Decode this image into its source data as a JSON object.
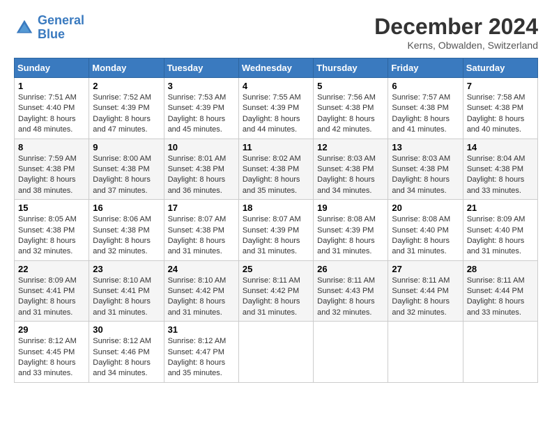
{
  "header": {
    "logo_line1": "General",
    "logo_line2": "Blue",
    "month": "December 2024",
    "location": "Kerns, Obwalden, Switzerland"
  },
  "columns": [
    "Sunday",
    "Monday",
    "Tuesday",
    "Wednesday",
    "Thursday",
    "Friday",
    "Saturday"
  ],
  "weeks": [
    [
      {
        "day": "1",
        "sunrise": "7:51 AM",
        "sunset": "4:40 PM",
        "daylight": "8 hours and 48 minutes."
      },
      {
        "day": "2",
        "sunrise": "7:52 AM",
        "sunset": "4:39 PM",
        "daylight": "8 hours and 47 minutes."
      },
      {
        "day": "3",
        "sunrise": "7:53 AM",
        "sunset": "4:39 PM",
        "daylight": "8 hours and 45 minutes."
      },
      {
        "day": "4",
        "sunrise": "7:55 AM",
        "sunset": "4:39 PM",
        "daylight": "8 hours and 44 minutes."
      },
      {
        "day": "5",
        "sunrise": "7:56 AM",
        "sunset": "4:38 PM",
        "daylight": "8 hours and 42 minutes."
      },
      {
        "day": "6",
        "sunrise": "7:57 AM",
        "sunset": "4:38 PM",
        "daylight": "8 hours and 41 minutes."
      },
      {
        "day": "7",
        "sunrise": "7:58 AM",
        "sunset": "4:38 PM",
        "daylight": "8 hours and 40 minutes."
      }
    ],
    [
      {
        "day": "8",
        "sunrise": "7:59 AM",
        "sunset": "4:38 PM",
        "daylight": "8 hours and 38 minutes."
      },
      {
        "day": "9",
        "sunrise": "8:00 AM",
        "sunset": "4:38 PM",
        "daylight": "8 hours and 37 minutes."
      },
      {
        "day": "10",
        "sunrise": "8:01 AM",
        "sunset": "4:38 PM",
        "daylight": "8 hours and 36 minutes."
      },
      {
        "day": "11",
        "sunrise": "8:02 AM",
        "sunset": "4:38 PM",
        "daylight": "8 hours and 35 minutes."
      },
      {
        "day": "12",
        "sunrise": "8:03 AM",
        "sunset": "4:38 PM",
        "daylight": "8 hours and 34 minutes."
      },
      {
        "day": "13",
        "sunrise": "8:03 AM",
        "sunset": "4:38 PM",
        "daylight": "8 hours and 34 minutes."
      },
      {
        "day": "14",
        "sunrise": "8:04 AM",
        "sunset": "4:38 PM",
        "daylight": "8 hours and 33 minutes."
      }
    ],
    [
      {
        "day": "15",
        "sunrise": "8:05 AM",
        "sunset": "4:38 PM",
        "daylight": "8 hours and 32 minutes."
      },
      {
        "day": "16",
        "sunrise": "8:06 AM",
        "sunset": "4:38 PM",
        "daylight": "8 hours and 32 minutes."
      },
      {
        "day": "17",
        "sunrise": "8:07 AM",
        "sunset": "4:38 PM",
        "daylight": "8 hours and 31 minutes."
      },
      {
        "day": "18",
        "sunrise": "8:07 AM",
        "sunset": "4:39 PM",
        "daylight": "8 hours and 31 minutes."
      },
      {
        "day": "19",
        "sunrise": "8:08 AM",
        "sunset": "4:39 PM",
        "daylight": "8 hours and 31 minutes."
      },
      {
        "day": "20",
        "sunrise": "8:08 AM",
        "sunset": "4:40 PM",
        "daylight": "8 hours and 31 minutes."
      },
      {
        "day": "21",
        "sunrise": "8:09 AM",
        "sunset": "4:40 PM",
        "daylight": "8 hours and 31 minutes."
      }
    ],
    [
      {
        "day": "22",
        "sunrise": "8:09 AM",
        "sunset": "4:41 PM",
        "daylight": "8 hours and 31 minutes."
      },
      {
        "day": "23",
        "sunrise": "8:10 AM",
        "sunset": "4:41 PM",
        "daylight": "8 hours and 31 minutes."
      },
      {
        "day": "24",
        "sunrise": "8:10 AM",
        "sunset": "4:42 PM",
        "daylight": "8 hours and 31 minutes."
      },
      {
        "day": "25",
        "sunrise": "8:11 AM",
        "sunset": "4:42 PM",
        "daylight": "8 hours and 31 minutes."
      },
      {
        "day": "26",
        "sunrise": "8:11 AM",
        "sunset": "4:43 PM",
        "daylight": "8 hours and 32 minutes."
      },
      {
        "day": "27",
        "sunrise": "8:11 AM",
        "sunset": "4:44 PM",
        "daylight": "8 hours and 32 minutes."
      },
      {
        "day": "28",
        "sunrise": "8:11 AM",
        "sunset": "4:44 PM",
        "daylight": "8 hours and 33 minutes."
      }
    ],
    [
      {
        "day": "29",
        "sunrise": "8:12 AM",
        "sunset": "4:45 PM",
        "daylight": "8 hours and 33 minutes."
      },
      {
        "day": "30",
        "sunrise": "8:12 AM",
        "sunset": "4:46 PM",
        "daylight": "8 hours and 34 minutes."
      },
      {
        "day": "31",
        "sunrise": "8:12 AM",
        "sunset": "4:47 PM",
        "daylight": "8 hours and 35 minutes."
      },
      null,
      null,
      null,
      null
    ]
  ]
}
